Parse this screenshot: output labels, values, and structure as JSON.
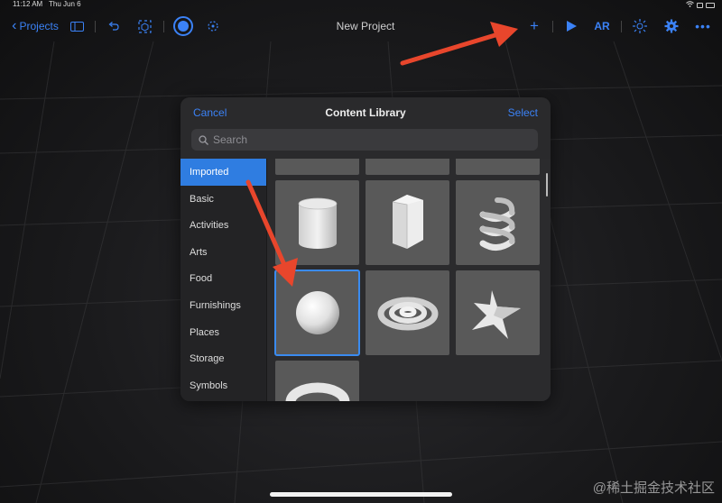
{
  "status": {
    "time": "11:12 AM",
    "date": "Thu Jun 6"
  },
  "toolbar": {
    "projects_label": "Projects",
    "title": "New Project",
    "add_icon": "plus-icon",
    "ar_label": "AR",
    "accent": "#3b82f6"
  },
  "library": {
    "cancel_label": "Cancel",
    "title": "Content Library",
    "select_label": "Select",
    "search_placeholder": "Search",
    "categories": [
      "Imported",
      "Basic",
      "Activities",
      "Arts",
      "Food",
      "Furnishings",
      "Places",
      "Storage",
      "Symbols"
    ],
    "selected_category": "Imported",
    "items": [
      "cylinder",
      "hexagonal-prism",
      "helix",
      "sphere",
      "spiral",
      "star",
      "torus"
    ],
    "selected_item": "sphere"
  },
  "watermark": "@稀土掘金技术社区",
  "colors": {
    "highlight": "#2f7de1",
    "arrow": "#e8462c"
  }
}
